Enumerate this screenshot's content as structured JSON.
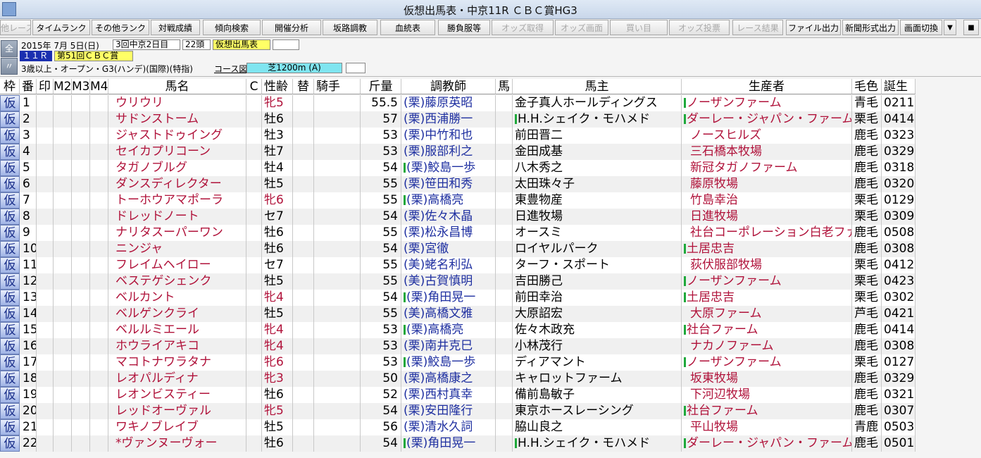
{
  "window": {
    "title": "仮想出馬表・中京11R ＣＢＣ賞HG3"
  },
  "toolbar": {
    "buttons": [
      {
        "label": "他レース",
        "enabled": false
      },
      {
        "label": "タイムランク",
        "enabled": true
      },
      {
        "label": "その他ランク",
        "enabled": true
      },
      {
        "label": "対戦成績",
        "enabled": true
      },
      {
        "label": "傾向検索",
        "enabled": true
      },
      {
        "label": "開催分析",
        "enabled": true
      },
      {
        "label": "坂路調教",
        "enabled": true
      },
      {
        "label": "血統表",
        "enabled": true
      },
      {
        "label": "勝負服等",
        "enabled": true
      },
      {
        "label": "オッズ取得",
        "enabled": false
      },
      {
        "label": "オッズ画面",
        "enabled": false
      },
      {
        "label": "買い目",
        "enabled": false
      },
      {
        "label": "オッズ投票",
        "enabled": false
      },
      {
        "label": "レース結果",
        "enabled": false
      },
      {
        "label": "ファイル出力",
        "enabled": true
      },
      {
        "label": "新聞形式出力",
        "enabled": true
      },
      {
        "label": "画面切換",
        "enabled": true
      }
    ]
  },
  "race": {
    "date": "2015年 7月 5日(日)",
    "meeting": "3回中京2日目",
    "heads": "22頭",
    "status": "仮想出馬表",
    "race_no": "１１Ｒ",
    "race_name": "第51回ＣＢＣ賞",
    "conditions": "3歳以上・オープン・G3(ハンデ)(国際)(特指)",
    "course_label": "コース図",
    "course": "芝1200m (A)",
    "side_top": "全",
    "side_bottom": "〃"
  },
  "columns": {
    "waku": "枠",
    "num": "番",
    "mark": "印",
    "m2": "M2",
    "m3": "M3",
    "m4": "M4",
    "horse": "馬名",
    "c": "C",
    "sexage": "性齢",
    "swap": "替",
    "jockey": "騎手",
    "weight": "斤量",
    "trainer": "調教師",
    "uma": "馬",
    "owner": "馬主",
    "breeder": "生産者",
    "color": "毛色",
    "birth": "誕生"
  },
  "rows": [
    {
      "waku": "仮",
      "num": "1",
      "horse": "ウリウリ",
      "sexage": "牝5",
      "weight": "55.5",
      "trainer": "(栗)藤原英昭",
      "tmark": false,
      "owner": "金子真人ホールディングス",
      "omark": false,
      "breeder": "ノーザンファーム",
      "bmark": true,
      "color": "青毛",
      "birth": "0211"
    },
    {
      "waku": "仮",
      "num": "2",
      "horse": "サドンストーム",
      "sexage": "牡6",
      "weight": "57",
      "trainer": "(栗)西浦勝一",
      "tmark": false,
      "owner": "H.H.シェイク・モハメド",
      "omark": true,
      "breeder": "ダーレー・ジャパン・ファーム",
      "bmark": true,
      "color": "栗毛",
      "birth": "0414"
    },
    {
      "waku": "仮",
      "num": "3",
      "horse": "ジャストドゥイング",
      "sexage": "牡3",
      "weight": "53",
      "trainer": "(栗)中竹和也",
      "tmark": false,
      "owner": "前田晋二",
      "omark": false,
      "breeder": "ノースヒルズ",
      "bmark": false,
      "color": "鹿毛",
      "birth": "0323"
    },
    {
      "waku": "仮",
      "num": "4",
      "horse": "セイカプリコーン",
      "sexage": "牡7",
      "weight": "53",
      "trainer": "(栗)服部利之",
      "tmark": false,
      "owner": "金田成基",
      "omark": false,
      "breeder": "三石橋本牧場",
      "bmark": false,
      "color": "鹿毛",
      "birth": "0329"
    },
    {
      "waku": "仮",
      "num": "5",
      "horse": "タガノブルグ",
      "sexage": "牡4",
      "weight": "54",
      "trainer": "(栗)鮫島一歩",
      "tmark": true,
      "owner": "八木秀之",
      "omark": false,
      "breeder": "新冠タガノファーム",
      "bmark": false,
      "color": "鹿毛",
      "birth": "0318"
    },
    {
      "waku": "仮",
      "num": "6",
      "horse": "ダンスディレクター",
      "sexage": "牡5",
      "weight": "55",
      "trainer": "(栗)笹田和秀",
      "tmark": false,
      "owner": "太田珠々子",
      "omark": false,
      "breeder": "藤原牧場",
      "bmark": false,
      "color": "鹿毛",
      "birth": "0320"
    },
    {
      "waku": "仮",
      "num": "7",
      "horse": "トーホウアマポーラ",
      "sexage": "牝6",
      "weight": "55",
      "trainer": "(栗)高橋亮",
      "tmark": true,
      "owner": "東豊物産",
      "omark": false,
      "breeder": "竹島幸治",
      "bmark": false,
      "color": "栗毛",
      "birth": "0129"
    },
    {
      "waku": "仮",
      "num": "8",
      "horse": "ドレッドノート",
      "sexage": "セ7",
      "weight": "54",
      "trainer": "(栗)佐々木晶",
      "tmark": false,
      "owner": "日進牧場",
      "omark": false,
      "breeder": "日進牧場",
      "bmark": false,
      "color": "栗毛",
      "birth": "0309"
    },
    {
      "waku": "仮",
      "num": "9",
      "horse": "ナリタスーパーワン",
      "sexage": "牡6",
      "weight": "55",
      "trainer": "(栗)松永昌博",
      "tmark": false,
      "owner": "オースミ",
      "omark": false,
      "breeder": "社台コーポレーション白老ファー",
      "bmark": false,
      "color": "鹿毛",
      "birth": "0508"
    },
    {
      "waku": "仮",
      "num": "10",
      "horse": "ニンジャ",
      "sexage": "牡6",
      "weight": "54",
      "trainer": "(栗)宮徹",
      "tmark": false,
      "owner": "ロイヤルパーク",
      "omark": false,
      "breeder": "土居忠吉",
      "bmark": true,
      "color": "鹿毛",
      "birth": "0308"
    },
    {
      "waku": "仮",
      "num": "11",
      "horse": "フレイムヘイロー",
      "sexage": "セ7",
      "weight": "55",
      "trainer": "(美)蛯名利弘",
      "tmark": false,
      "owner": "ターフ・スポート",
      "omark": false,
      "breeder": "荻伏服部牧場",
      "bmark": false,
      "color": "栗毛",
      "birth": "0412"
    },
    {
      "waku": "仮",
      "num": "12",
      "horse": "ベステゲシェンク",
      "sexage": "牡5",
      "weight": "55",
      "trainer": "(美)古賀慎明",
      "tmark": false,
      "owner": "吉田勝己",
      "omark": false,
      "breeder": "ノーザンファーム",
      "bmark": true,
      "color": "栗毛",
      "birth": "0423"
    },
    {
      "waku": "仮",
      "num": "13",
      "horse": "ベルカント",
      "sexage": "牝4",
      "weight": "54",
      "trainer": "(栗)角田晃一",
      "tmark": true,
      "owner": "前田幸治",
      "omark": false,
      "breeder": "土居忠吉",
      "bmark": true,
      "color": "栗毛",
      "birth": "0302"
    },
    {
      "waku": "仮",
      "num": "14",
      "horse": "ベルゲンクライ",
      "sexage": "牡5",
      "weight": "55",
      "trainer": "(美)高橋文雅",
      "tmark": false,
      "owner": "大原詔宏",
      "omark": false,
      "breeder": "大原ファーム",
      "bmark": false,
      "color": "芦毛",
      "birth": "0421"
    },
    {
      "waku": "仮",
      "num": "15",
      "horse": "ベルルミエール",
      "sexage": "牝4",
      "weight": "53",
      "trainer": "(栗)高橋亮",
      "tmark": true,
      "owner": "佐々木政充",
      "omark": false,
      "breeder": "社台ファーム",
      "bmark": true,
      "color": "鹿毛",
      "birth": "0414"
    },
    {
      "waku": "仮",
      "num": "16",
      "horse": "ホウライアキコ",
      "sexage": "牝4",
      "weight": "53",
      "trainer": "(栗)南井克巳",
      "tmark": false,
      "owner": "小林茂行",
      "omark": false,
      "breeder": "ナカノファーム",
      "bmark": false,
      "color": "鹿毛",
      "birth": "0308"
    },
    {
      "waku": "仮",
      "num": "17",
      "horse": "マコトナワラタナ",
      "sexage": "牝6",
      "weight": "53",
      "trainer": "(栗)鮫島一歩",
      "tmark": true,
      "owner": "ディアマント",
      "omark": false,
      "breeder": "ノーザンファーム",
      "bmark": true,
      "color": "栗毛",
      "birth": "0127"
    },
    {
      "waku": "仮",
      "num": "18",
      "horse": "レオパルディナ",
      "sexage": "牝3",
      "weight": "50",
      "trainer": "(栗)高橋康之",
      "tmark": false,
      "owner": "キャロットファーム",
      "omark": false,
      "breeder": "坂東牧場",
      "bmark": false,
      "color": "鹿毛",
      "birth": "0329"
    },
    {
      "waku": "仮",
      "num": "19",
      "horse": "レオンビスティー",
      "sexage": "牡6",
      "weight": "52",
      "trainer": "(栗)西村真幸",
      "tmark": false,
      "owner": "備前島敏子",
      "omark": false,
      "breeder": "下河辺牧場",
      "bmark": false,
      "color": "鹿毛",
      "birth": "0321"
    },
    {
      "waku": "仮",
      "num": "20",
      "horse": "レッドオーヴァル",
      "sexage": "牝5",
      "weight": "54",
      "trainer": "(栗)安田隆行",
      "tmark": false,
      "owner": "東京ホースレーシング",
      "omark": false,
      "breeder": "社台ファーム",
      "bmark": true,
      "color": "鹿毛",
      "birth": "0307"
    },
    {
      "waku": "仮",
      "num": "21",
      "horse": "ワキノブレイブ",
      "sexage": "牡5",
      "weight": "56",
      "trainer": "(栗)清水久詞",
      "tmark": false,
      "owner": "脇山良之",
      "omark": false,
      "breeder": "平山牧場",
      "bmark": false,
      "color": "青鹿",
      "birth": "0503"
    },
    {
      "waku": "仮",
      "num": "22",
      "horse": "*ヴァンヌーヴォー",
      "sexage": "牡6",
      "weight": "54",
      "trainer": "(栗)角田晃一",
      "tmark": true,
      "owner": "H.H.シェイク・モハメド",
      "omark": true,
      "breeder": "ダーレー・ジャパン・ファーム",
      "bmark": true,
      "color": "鹿毛",
      "birth": "0501"
    }
  ],
  "colors": {
    "horse_name": "#b0123a",
    "trainer": "#1e2fa0",
    "breeder": "#b0123a",
    "mark": "#1ea83a",
    "waku": "#1a2f8a"
  }
}
